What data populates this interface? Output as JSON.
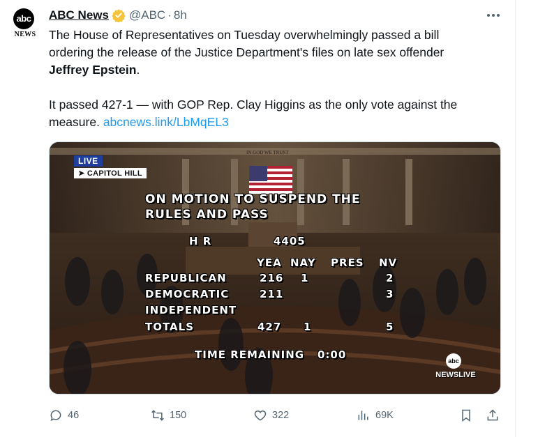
{
  "account": {
    "avatar_logo_text": "abc",
    "avatar_word": "NEWS",
    "name": "ABC News",
    "handle": "@ABC",
    "separator": "·",
    "time": "8h"
  },
  "post": {
    "text_line_1": "The House of Representatives on Tuesday overwhelmingly passed a bill",
    "text_line_2": "ordering the release of the Justice Department's files on late sex offender",
    "text_bold": "Jeffrey Epstein",
    "text_period": ".",
    "text_para2": "It passed 427-1 — with GOP Rep. Clay Higgins as the only vote against the measure.",
    "link": "abcnews.link/LbMqEL3"
  },
  "media": {
    "live_label": "LIVE",
    "location_label": "➤ CAPITOL HILL",
    "motion_line_1": "ON MOTION TO SUSPEND THE",
    "motion_line_2": "RULES AND PASS",
    "bill_label": "H R",
    "bill_number": "4405",
    "columns": [
      "YEA",
      "NAY",
      "PRES",
      "NV"
    ],
    "rows": [
      {
        "party": "REPUBLICAN",
        "yea": "216",
        "nay": "1",
        "pres": "",
        "nv": "2"
      },
      {
        "party": "DEMOCRATIC",
        "yea": "211",
        "nay": "",
        "pres": "",
        "nv": "3"
      },
      {
        "party": "INDEPENDENT",
        "yea": "",
        "nay": "",
        "pres": "",
        "nv": ""
      },
      {
        "party": "TOTALS",
        "yea": "427",
        "nay": "1",
        "pres": "",
        "nv": "5"
      }
    ],
    "time_label": "TIME REMAINING",
    "time_value": "0:00",
    "network_logo_text": "abc",
    "network_word": "NEWSLIVE",
    "chamber_motto": "IN GOD WE TRUST"
  },
  "actions": {
    "replies": "46",
    "reposts": "150",
    "likes": "322",
    "views": "69K"
  },
  "colors": {
    "link": "#1d9bf0",
    "verified": "#f6c33c",
    "secondary_text": "#536471",
    "live_badge": "#1f3f9e"
  },
  "icons": {
    "reply": "reply-icon",
    "repost": "repost-icon",
    "like": "heart-icon",
    "views": "views-icon",
    "bookmark": "bookmark-icon",
    "share": "share-icon",
    "more": "more-icon",
    "verified": "verified-badge-icon"
  }
}
